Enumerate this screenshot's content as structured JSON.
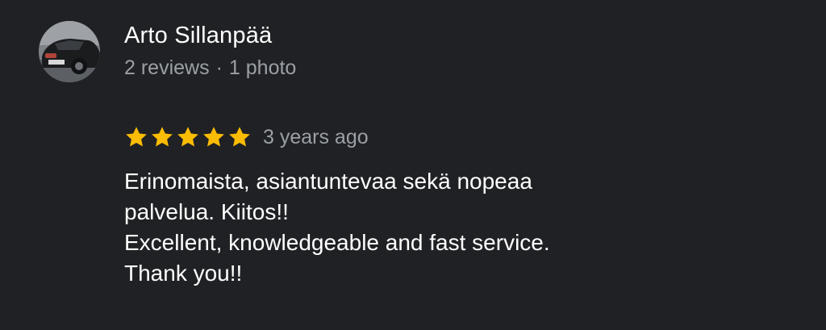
{
  "review": {
    "author": {
      "name": "Arto Sillanpää",
      "reviews_count": "2 reviews",
      "separator": "·",
      "photos_count": "1 photo",
      "avatar_icon": "car-photo-avatar"
    },
    "rating": {
      "stars": 5,
      "max_stars": 5,
      "star_color": "#fbbc04",
      "date": "3 years ago"
    },
    "text_lines": [
      "Erinomaista, asiantuntevaa sekä nopeaa",
      "palvelua. Kiitos!!",
      "Excellent, knowledgeable and fast service.",
      "Thank you!!"
    ]
  },
  "colors": {
    "background": "#202124",
    "primary_text": "#ffffff",
    "secondary_text": "#9aa0a6"
  }
}
